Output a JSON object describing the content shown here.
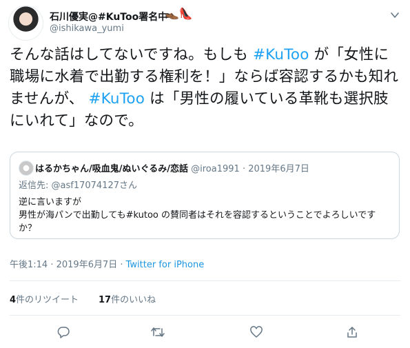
{
  "header": {
    "display_name": "石川優実@#KuToo署名中",
    "handle": "@ishikawa_yumi",
    "shoe_icons": "👞👠"
  },
  "tweet": {
    "segments": [
      "そんな話はしてないですね。もしも ",
      "#KuToo",
      " が「女性に職場に水着で出勤する権利を！」ならば容認するかも知れませんが、 ",
      "#KuToo",
      " は「男性の履いている革靴も選択肢にいれて」なので。"
    ]
  },
  "quote": {
    "name": "はるかちゃん/吸血鬼/ぬいぐるみ/恋話",
    "handle": "@iroa1991",
    "date": "· 2019年6月7日",
    "reply_to": "返信先: @asf17074127さん",
    "body_line1": "逆に言いますが",
    "body_line2": "男性が海パンで出勤しても#kutoo の賛同者はそれを容認するということでよろしいですか？"
  },
  "meta": {
    "time": "午後1:14",
    "date": "· 2019年6月7日 ·",
    "source": "Twitter for iPhone"
  },
  "stats": {
    "retweet_count": "4",
    "retweet_label": "件のリツイート",
    "like_count": "17",
    "like_label": "件のいいね"
  },
  "colors": {
    "accent": "#1da1f2",
    "muted": "#657786",
    "text": "#14171a"
  }
}
